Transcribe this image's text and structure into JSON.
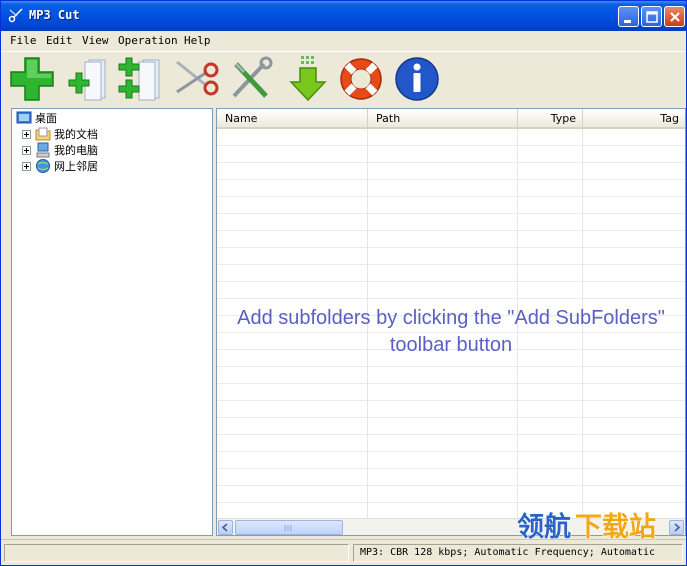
{
  "window": {
    "title": "MP3 Cut"
  },
  "menu": [
    "File",
    "Edit",
    "View",
    "Operation",
    "Help"
  ],
  "toolbar": {
    "buttons": [
      "add-icon",
      "add-files-icon",
      "add-subfolders-icon",
      "cut-icon",
      "tools-icon",
      "download-icon",
      "help-lifebuoy-icon",
      "info-icon"
    ]
  },
  "tree": {
    "root": "桌面",
    "items": [
      "我的文档",
      "我的电脑",
      "网上邻居"
    ]
  },
  "list": {
    "columns": [
      "Name",
      "Path",
      "Type",
      "Tag"
    ],
    "empty_hint_line1": "Add subfolders by clicking the \"Add SubFolders\"",
    "empty_hint_line2": "toolbar button"
  },
  "status": {
    "right": "MP3:  CBR 128 kbps; Automatic Frequency; Automatic"
  },
  "watermark": {
    "text": "领航下载站"
  },
  "colors": {
    "title_bar": "#0054e3",
    "hint_text": "#5a5fc4",
    "window_bg": "#ece9d8"
  }
}
